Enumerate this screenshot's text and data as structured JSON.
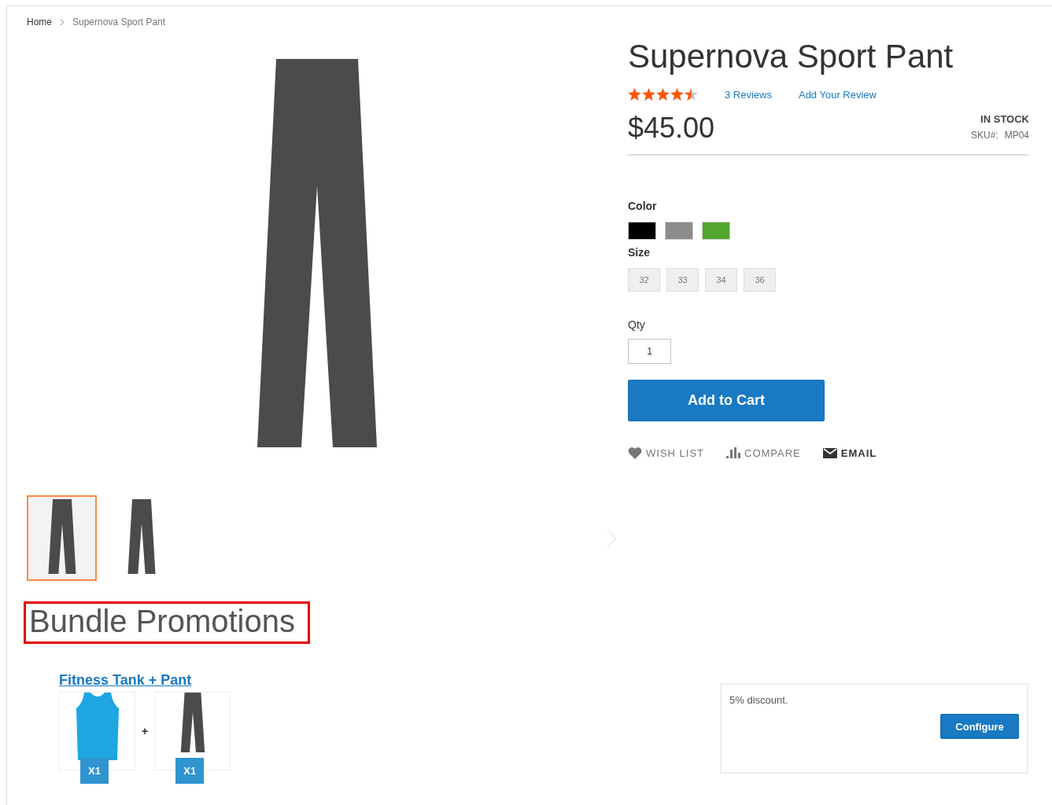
{
  "breadcrumbs": [
    {
      "label": "Home"
    },
    {
      "label": "Supernova Sport Pant"
    }
  ],
  "gallery": {
    "thumbnails": [
      {
        "selected": true
      },
      {
        "selected": false
      }
    ]
  },
  "product": {
    "title": "Supernova Sport Pant",
    "stars": 4.5,
    "reviews_link": "3 Reviews",
    "add_review_link": "Add Your Review",
    "price": "$45.00",
    "stock": "IN STOCK",
    "sku_label": "SKU#:",
    "sku": "MP04",
    "color_label": "Color",
    "colors": [
      {
        "color": "#000000"
      },
      {
        "color": "#8c8c8c"
      },
      {
        "color": "#53a62d"
      }
    ],
    "size_label": "Size",
    "sizes": [
      {
        "label": "32"
      },
      {
        "label": "33"
      },
      {
        "label": "34"
      },
      {
        "label": "36"
      }
    ],
    "qty_label": "Qty",
    "qty": "1",
    "add_to_cart": "Add to Cart",
    "actions": [
      {
        "kind": "wishlist",
        "label": "WISH LIST"
      },
      {
        "kind": "compare",
        "label": "COMPARE"
      },
      {
        "kind": "email",
        "label": "EMAIL"
      }
    ]
  },
  "bundle": {
    "heading": "Bundle Promotions",
    "offers": [
      {
        "title": "Fitness Tank + Pant",
        "plus": "+",
        "description": "5% discount.",
        "button": "Configure",
        "items": [
          {
            "kind": "tank",
            "quantity": "X1"
          },
          {
            "kind": "pant",
            "quantity": "X1"
          }
        ]
      }
    ]
  }
}
